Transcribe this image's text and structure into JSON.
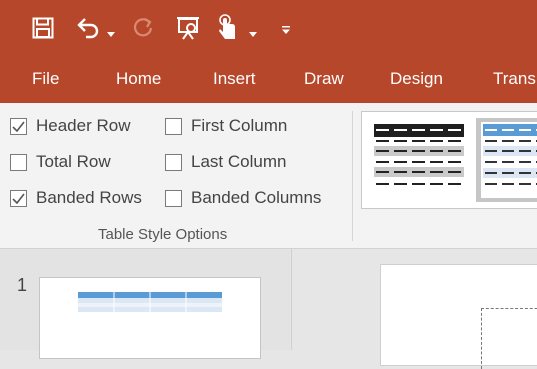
{
  "ribbon_tabs": [
    "File",
    "Home",
    "Insert",
    "Draw",
    "Design",
    "Trans"
  ],
  "table_style_options": {
    "header_row": {
      "label": "Header Row",
      "checked": true
    },
    "total_row": {
      "label": "Total Row",
      "checked": false
    },
    "banded_rows": {
      "label": "Banded Rows",
      "checked": true
    },
    "first_column": {
      "label": "First Column",
      "checked": false
    },
    "last_column": {
      "label": "Last Column",
      "checked": false
    },
    "banded_columns": {
      "label": "Banded Columns",
      "checked": false
    },
    "group_label": "Table Style Options"
  },
  "quick_access_icons": [
    "save-icon",
    "undo-icon",
    "redo-icon",
    "present-from-start-icon",
    "touch-mode-icon",
    "customize-qat-icon"
  ],
  "slide_panel": {
    "slide_number": "1"
  },
  "colors": {
    "accent": "#b7472a",
    "ribbon_bg": "#f3f3f3",
    "table_blue": "#5b9bd5"
  }
}
